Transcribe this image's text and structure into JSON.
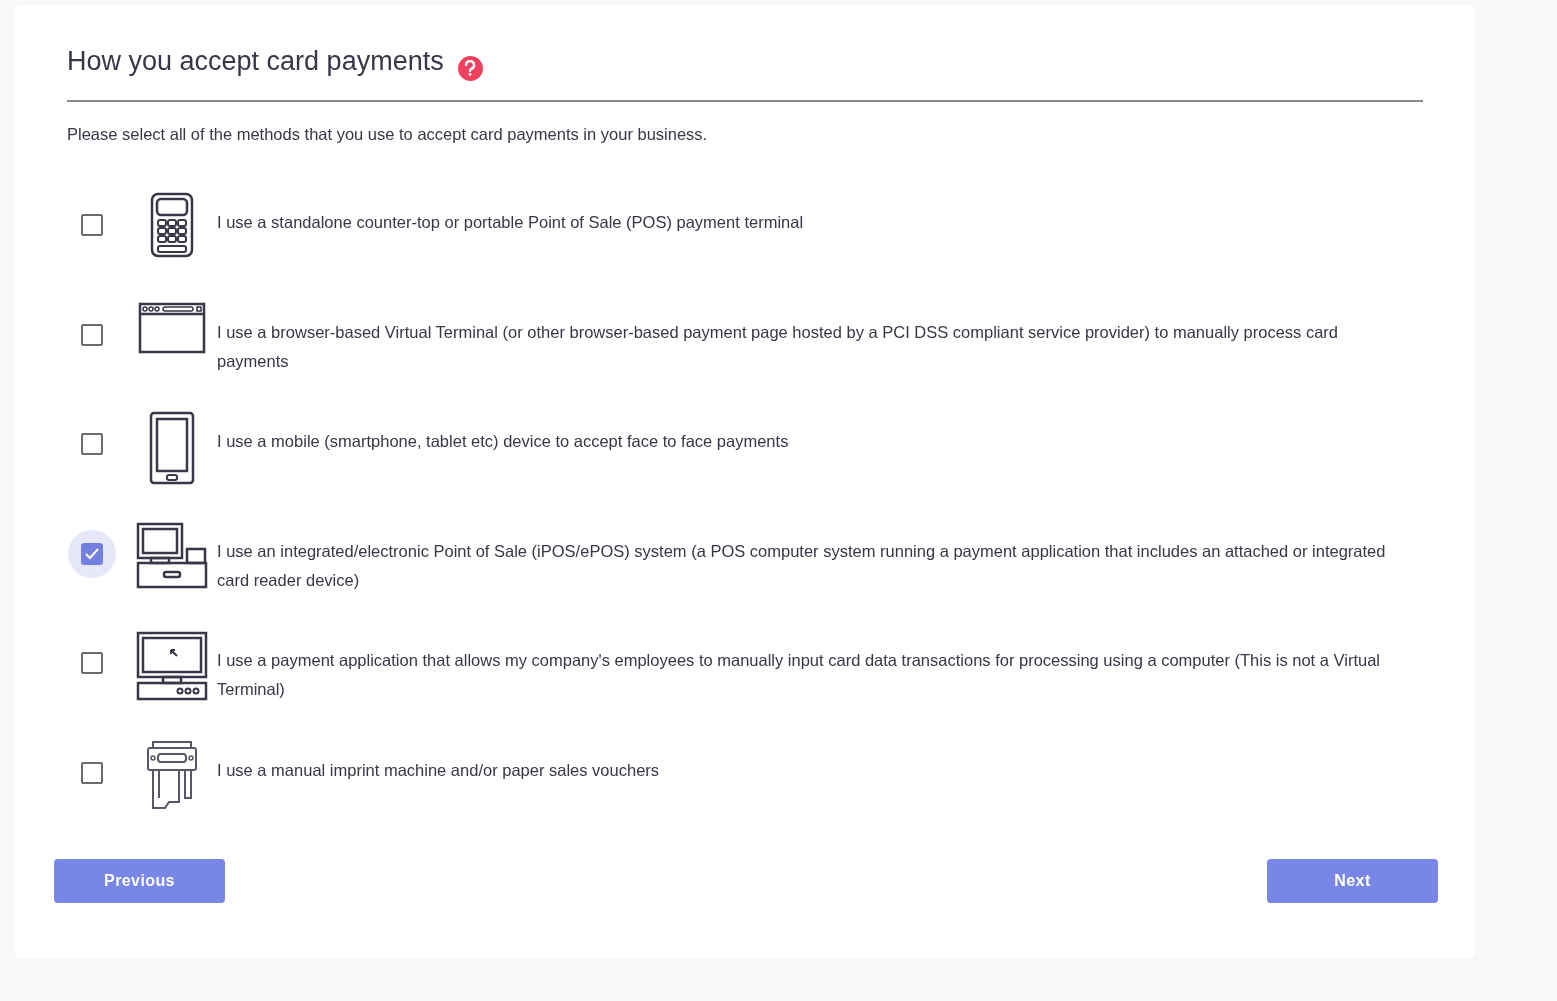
{
  "heading": "How you accept card payments",
  "intro": "Please select all of the methods that you use to accept card payments in your business.",
  "options": [
    {
      "kind": "terminal",
      "label": "I use a standalone counter-top or portable Point of Sale (POS) payment terminal",
      "checked": false
    },
    {
      "kind": "browser",
      "label": "I use a browser-based Virtual Terminal (or other browser-based payment page hosted by a PCI DSS compliant service provider) to manually process card payments",
      "checked": false
    },
    {
      "kind": "mobile",
      "label": "I use a mobile (smartphone, tablet etc) device to accept face to face payments",
      "checked": false
    },
    {
      "kind": "epos",
      "label": "I use an integrated/electronic Point of Sale (iPOS/ePOS) system (a POS computer system running a payment application that includes an attached or integrated card reader device)",
      "checked": true
    },
    {
      "kind": "computer",
      "label": "I use a payment application that allows my company's employees to manually input card data transactions for processing using a computer (This is not a Virtual Terminal)",
      "checked": false
    },
    {
      "kind": "imprint",
      "label": "I use a manual imprint machine and/or paper sales vouchers",
      "checked": false
    }
  ],
  "buttons": {
    "previous": "Previous",
    "next": "Next"
  }
}
